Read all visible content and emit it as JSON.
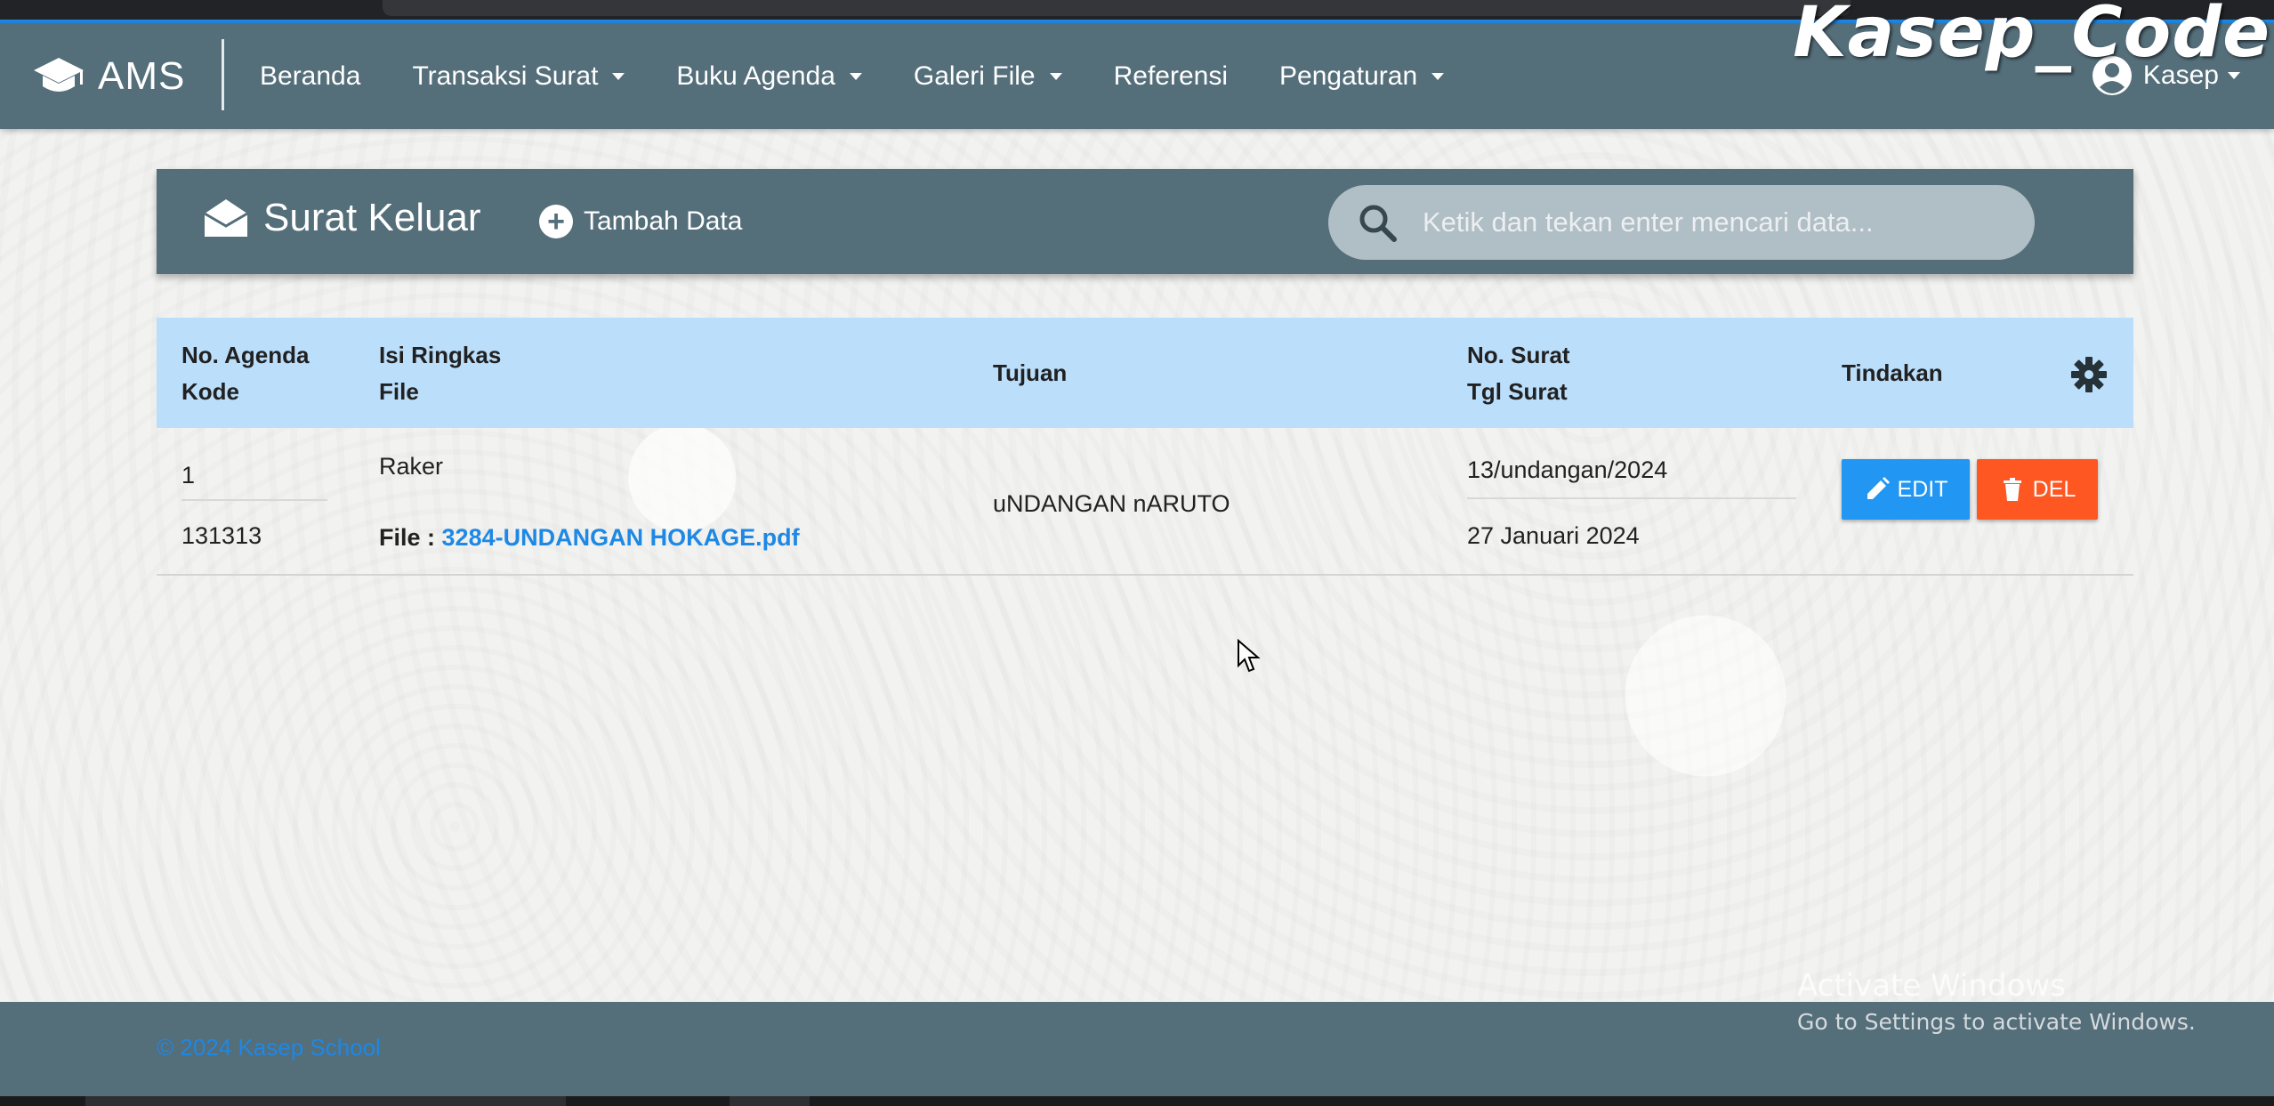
{
  "watermark": "Kasep_Code",
  "navbar": {
    "brand": "AMS",
    "items": [
      {
        "label": "Beranda",
        "dropdown": false
      },
      {
        "label": "Transaksi Surat",
        "dropdown": true
      },
      {
        "label": "Buku Agenda",
        "dropdown": true
      },
      {
        "label": "Galeri File",
        "dropdown": true
      },
      {
        "label": "Referensi",
        "dropdown": false
      },
      {
        "label": "Pengaturan",
        "dropdown": true
      }
    ],
    "user": "Kasep"
  },
  "page": {
    "title": "Surat Keluar",
    "add_label": "Tambah Data",
    "search_placeholder": "Ketik dan tekan enter mencari data..."
  },
  "table": {
    "headers": {
      "col1_line1": "No. Agenda",
      "col1_line2": "Kode",
      "col2_line1": "Isi Ringkas",
      "col2_line2": "File",
      "col3": "Tujuan",
      "col4_line1": "No. Surat",
      "col4_line2": "Tgl Surat",
      "col5": "Tindakan"
    },
    "rows": [
      {
        "no_agenda": "1",
        "kode": "131313",
        "isi_ringkas": "Raker",
        "file_label": "File :",
        "file_name": "3284-UNDANGAN HOKAGE.pdf",
        "tujuan": "uNDANGAN nARUTO",
        "no_surat": "13/undangan/2024",
        "tgl_surat": "27 Januari 2024",
        "edit_label": "EDIT",
        "del_label": "DEL"
      }
    ]
  },
  "footer": {
    "copyright": "© 2024 Kasep School"
  },
  "os_overlay": {
    "line1": "Activate Windows",
    "line2": "Go to Settings to activate Windows."
  },
  "colors": {
    "primary": "#546e7a",
    "header_row": "#bbdefb",
    "edit": "#2196f3",
    "del": "#ff5722",
    "link": "#1e88e5"
  }
}
